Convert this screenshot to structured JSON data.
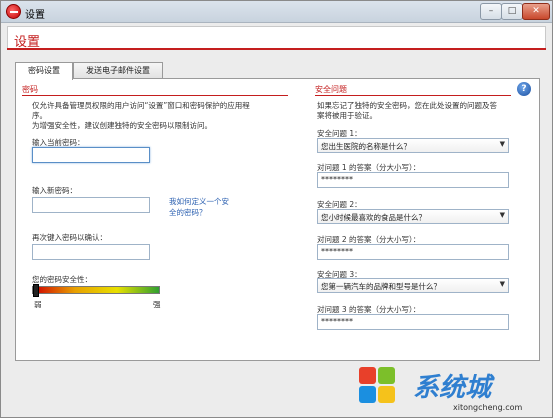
{
  "window": {
    "title": "设置"
  },
  "header": {
    "title": "设置"
  },
  "tabs": [
    {
      "label": "密码设置"
    },
    {
      "label": "发送电子邮件设置"
    }
  ],
  "password": {
    "section_title": "密码",
    "description_1": "仅允许具备管理员权限的用户访问“设置”窗口和密码保护的应用程",
    "description_2": "序。",
    "description_3": "为增强安全性，建议创建独特的安全密码以限制访问。",
    "current_label": "输入当前密码：",
    "current_value": "",
    "new_label": "输入新密码：",
    "new_value": "",
    "help_link_1": "我如何定义一个安",
    "help_link_2": "全的密码？",
    "confirm_label": "再次键入密码以确认：",
    "confirm_value": "",
    "strength_label": "您的密码安全性：",
    "strength_level": 0,
    "weak_label": "弱",
    "strong_label": "强"
  },
  "security": {
    "section_title": "安全问题",
    "description_1": "如果忘记了独特的安全密码，您在此处设置的问题及答",
    "description_2": "案将被用于验证。",
    "questions": [
      {
        "label": "安全问题 1：",
        "value": "您出生医院的名称是什么？",
        "answer_label": "对问题 1 的答案（分大小写）：",
        "answer_value": "********"
      },
      {
        "label": "安全问题 2：",
        "value": "您小时候最喜欢的食品是什么？",
        "answer_label": "对问题 2 的答案（分大小写）：",
        "answer_value": "********"
      },
      {
        "label": "安全问题 3：",
        "value": "您第一辆汽车的品牌和型号是什么？",
        "answer_label": "对问题 3 的答案（分大小写）：",
        "answer_value": "********"
      }
    ]
  },
  "watermark": {
    "text": "系统城",
    "url": "xitongcheng.com"
  },
  "colors": {
    "accent": "#c41e1e",
    "link": "#2a5fb0"
  },
  "icons": {
    "help": "help-icon",
    "app": "app-logo-icon",
    "dropdown": "chevron-down-icon"
  }
}
